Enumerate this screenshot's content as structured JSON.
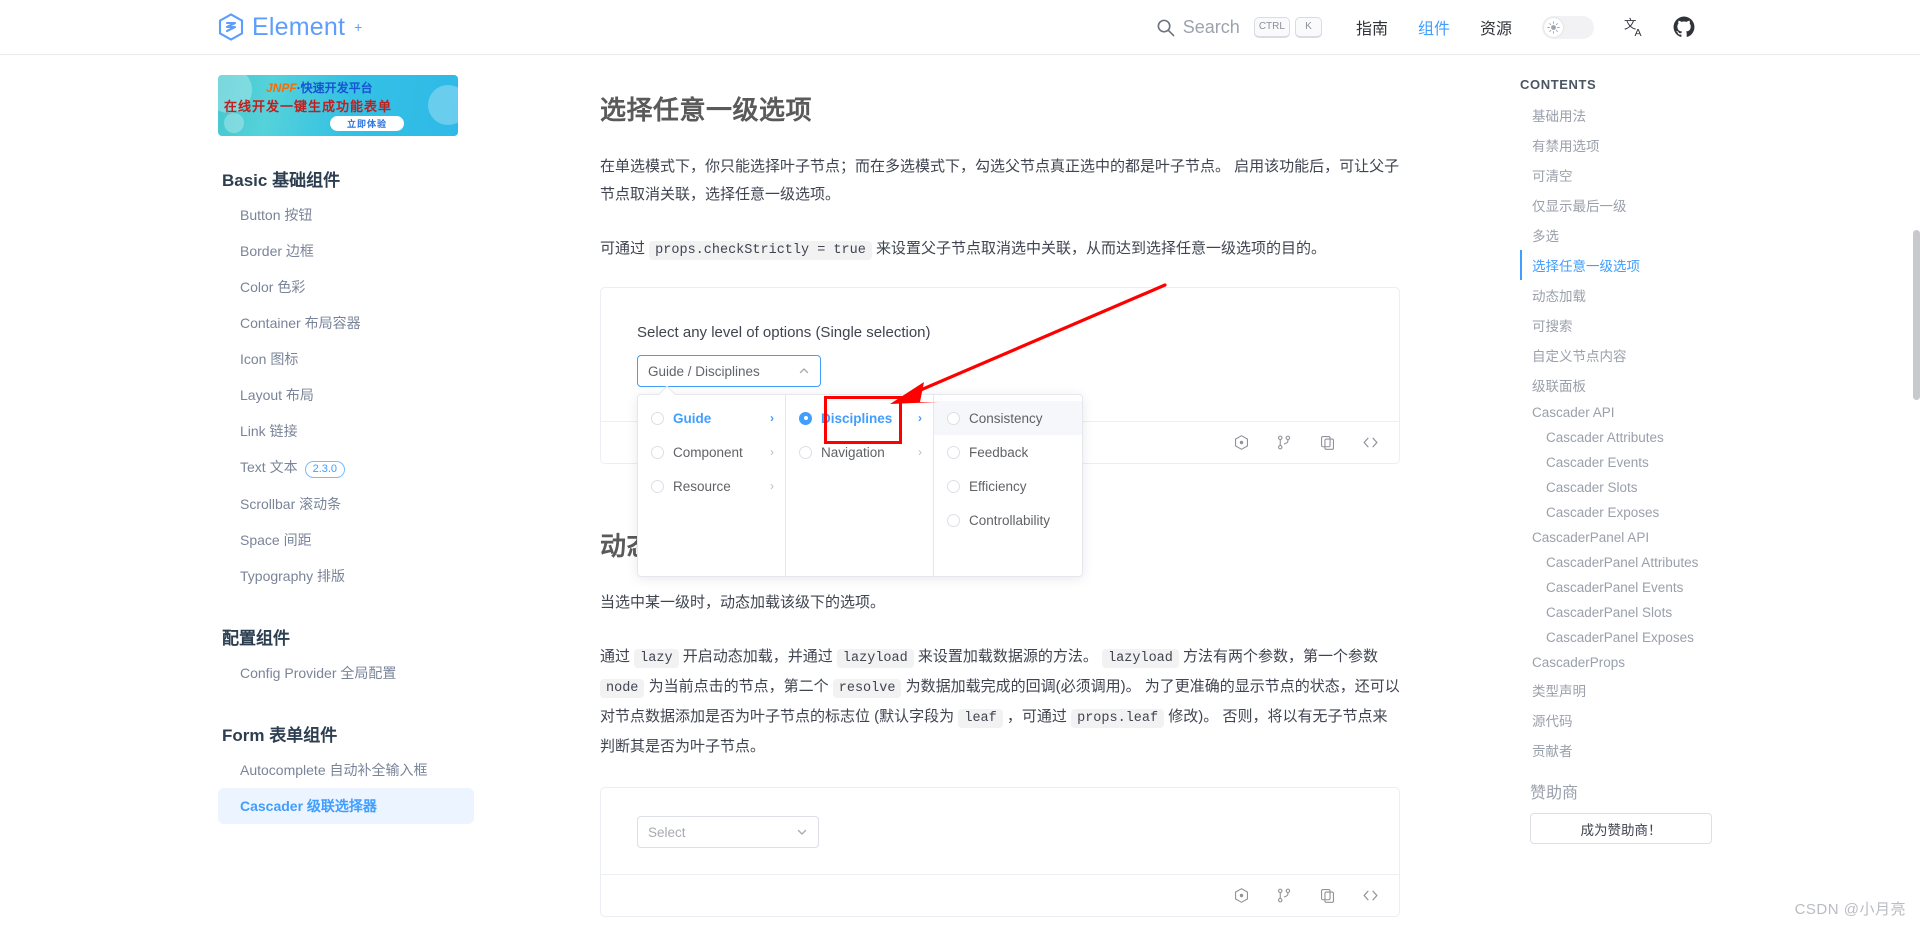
{
  "header": {
    "logo_text": "Element",
    "logo_plus": "+",
    "search_placeholder": "Search",
    "kbd_ctrl": "CTRL",
    "kbd_k": "K",
    "nav": [
      {
        "label": "指南",
        "active": false
      },
      {
        "label": "组件",
        "active": true
      },
      {
        "label": "资源",
        "active": false
      }
    ],
    "icons": {
      "search": "search-icon",
      "theme": "sun-icon",
      "language": "translate-icon",
      "github": "github-icon"
    }
  },
  "sidebar": {
    "banner": {
      "brand": "JNPF",
      "headline": "·快速开发平台",
      "subline": "在线开发一键生成功能表单",
      "cta": "立即体验"
    },
    "groups": [
      {
        "title": "Basic 基础组件",
        "items": [
          {
            "label": "Button 按钮"
          },
          {
            "label": "Border 边框"
          },
          {
            "label": "Color 色彩"
          },
          {
            "label": "Container 布局容器"
          },
          {
            "label": "Icon 图标"
          },
          {
            "label": "Layout 布局"
          },
          {
            "label": "Link 链接"
          },
          {
            "label": "Text 文本",
            "badge": "2.3.0"
          },
          {
            "label": "Scrollbar 滚动条"
          },
          {
            "label": "Space 间距"
          },
          {
            "label": "Typography 排版"
          }
        ]
      },
      {
        "title": "配置组件",
        "items": [
          {
            "label": "Config Provider 全局配置"
          }
        ]
      },
      {
        "title": "Form 表单组件",
        "items": [
          {
            "label": "Autocomplete 自动补全输入框"
          },
          {
            "label": "Cascader 级联选择器",
            "active": true
          }
        ]
      }
    ]
  },
  "main": {
    "title": "选择任意一级选项",
    "para1": "在单选模式下，你只能选择叶子节点；而在多选模式下，勾选父节点真正选中的都是叶子节点。 启用该功能后，可让父子节点取消关联，选择任意一级选项。",
    "para2_prefix": "可通过 ",
    "para2_code": "props.checkStrictly = true",
    "para2_suffix": " 来设置父子节点取消选中关联，从而达到选择任意一级选项的目的。",
    "demo1": {
      "label": "Select any level of options (Single selection)",
      "input_value": "Guide / Disciplines",
      "columns": [
        {
          "items": [
            {
              "label": "Guide",
              "active": true,
              "checked": false,
              "has_children": true
            },
            {
              "label": "Component",
              "active": false,
              "checked": false,
              "has_children": true
            },
            {
              "label": "Resource",
              "active": false,
              "checked": false,
              "has_children": true
            }
          ]
        },
        {
          "items": [
            {
              "label": "Disciplines",
              "active": true,
              "checked": true,
              "has_children": true
            },
            {
              "label": "Navigation",
              "active": false,
              "checked": false,
              "has_children": true
            }
          ]
        },
        {
          "items": [
            {
              "label": "Consistency",
              "active": false,
              "checked": false,
              "highlight": true,
              "has_children": false
            },
            {
              "label": "Feedback",
              "active": false,
              "checked": false,
              "has_children": false
            },
            {
              "label": "Efficiency",
              "active": false,
              "checked": false,
              "has_children": false
            },
            {
              "label": "Controllability",
              "active": false,
              "checked": false,
              "has_children": false
            }
          ]
        }
      ]
    },
    "section2": {
      "title": "动态加载",
      "para1": "当选中某一级时，动态加载该级下的选项。",
      "para2_a": "通过 ",
      "code_lazy": "lazy",
      "para2_b": " 开启动态加载，并通过 ",
      "code_lazyload": "lazyload",
      "para2_c": " 来设置加载数据源的方法。 ",
      "code_lazyload2": "lazyload",
      "para2_d": " 方法有两个参数，第一个参数 ",
      "code_node": "node",
      "para2_e": " 为当前点击的节点，第二个 ",
      "code_resolve": "resolve",
      "para2_f": " 为数据加载完成的回调(必须调用)。 为了更准确的显示节点的状态，还可以对节点数据添加是否为叶子节点的标志位 (默认字段为 ",
      "code_leaf": "leaf",
      "para2_g": " ，可通过 ",
      "code_propsleaf": "props.leaf",
      "para2_h": " 修改)。 否则，将以有无子节点来判断其是否为叶子节点。",
      "select_placeholder": "Select"
    }
  },
  "toc": {
    "title": "CONTENTS",
    "items": [
      {
        "label": "基础用法",
        "level": 1
      },
      {
        "label": "有禁用选项",
        "level": 1
      },
      {
        "label": "可清空",
        "level": 1
      },
      {
        "label": "仅显示最后一级",
        "level": 1
      },
      {
        "label": "多选",
        "level": 1
      },
      {
        "label": "选择任意一级选项",
        "level": 1,
        "active": true
      },
      {
        "label": "动态加载",
        "level": 1
      },
      {
        "label": "可搜索",
        "level": 1
      },
      {
        "label": "自定义节点内容",
        "level": 1
      },
      {
        "label": "级联面板",
        "level": 1
      },
      {
        "label": "Cascader API",
        "level": 1
      },
      {
        "label": "Cascader Attributes",
        "level": 2
      },
      {
        "label": "Cascader Events",
        "level": 2
      },
      {
        "label": "Cascader Slots",
        "level": 2
      },
      {
        "label": "Cascader Exposes",
        "level": 2
      },
      {
        "label": "CascaderPanel API",
        "level": 1
      },
      {
        "label": "CascaderPanel Attributes",
        "level": 2
      },
      {
        "label": "CascaderPanel Events",
        "level": 2
      },
      {
        "label": "CascaderPanel Slots",
        "level": 2
      },
      {
        "label": "CascaderPanel Exposes",
        "level": 2
      },
      {
        "label": "CascaderProps",
        "level": 1
      },
      {
        "label": "类型声明",
        "level": 1
      },
      {
        "label": "源代码",
        "level": 1
      },
      {
        "label": "贡献者",
        "level": 1
      }
    ],
    "sponsor_title": "赞助商",
    "sponsor_button": "成为赞助商！"
  },
  "watermark": "CSDN @小月亮",
  "colors": {
    "primary": "#409eff",
    "annotation": "#ff0000",
    "muted": "#9aa0ab"
  }
}
